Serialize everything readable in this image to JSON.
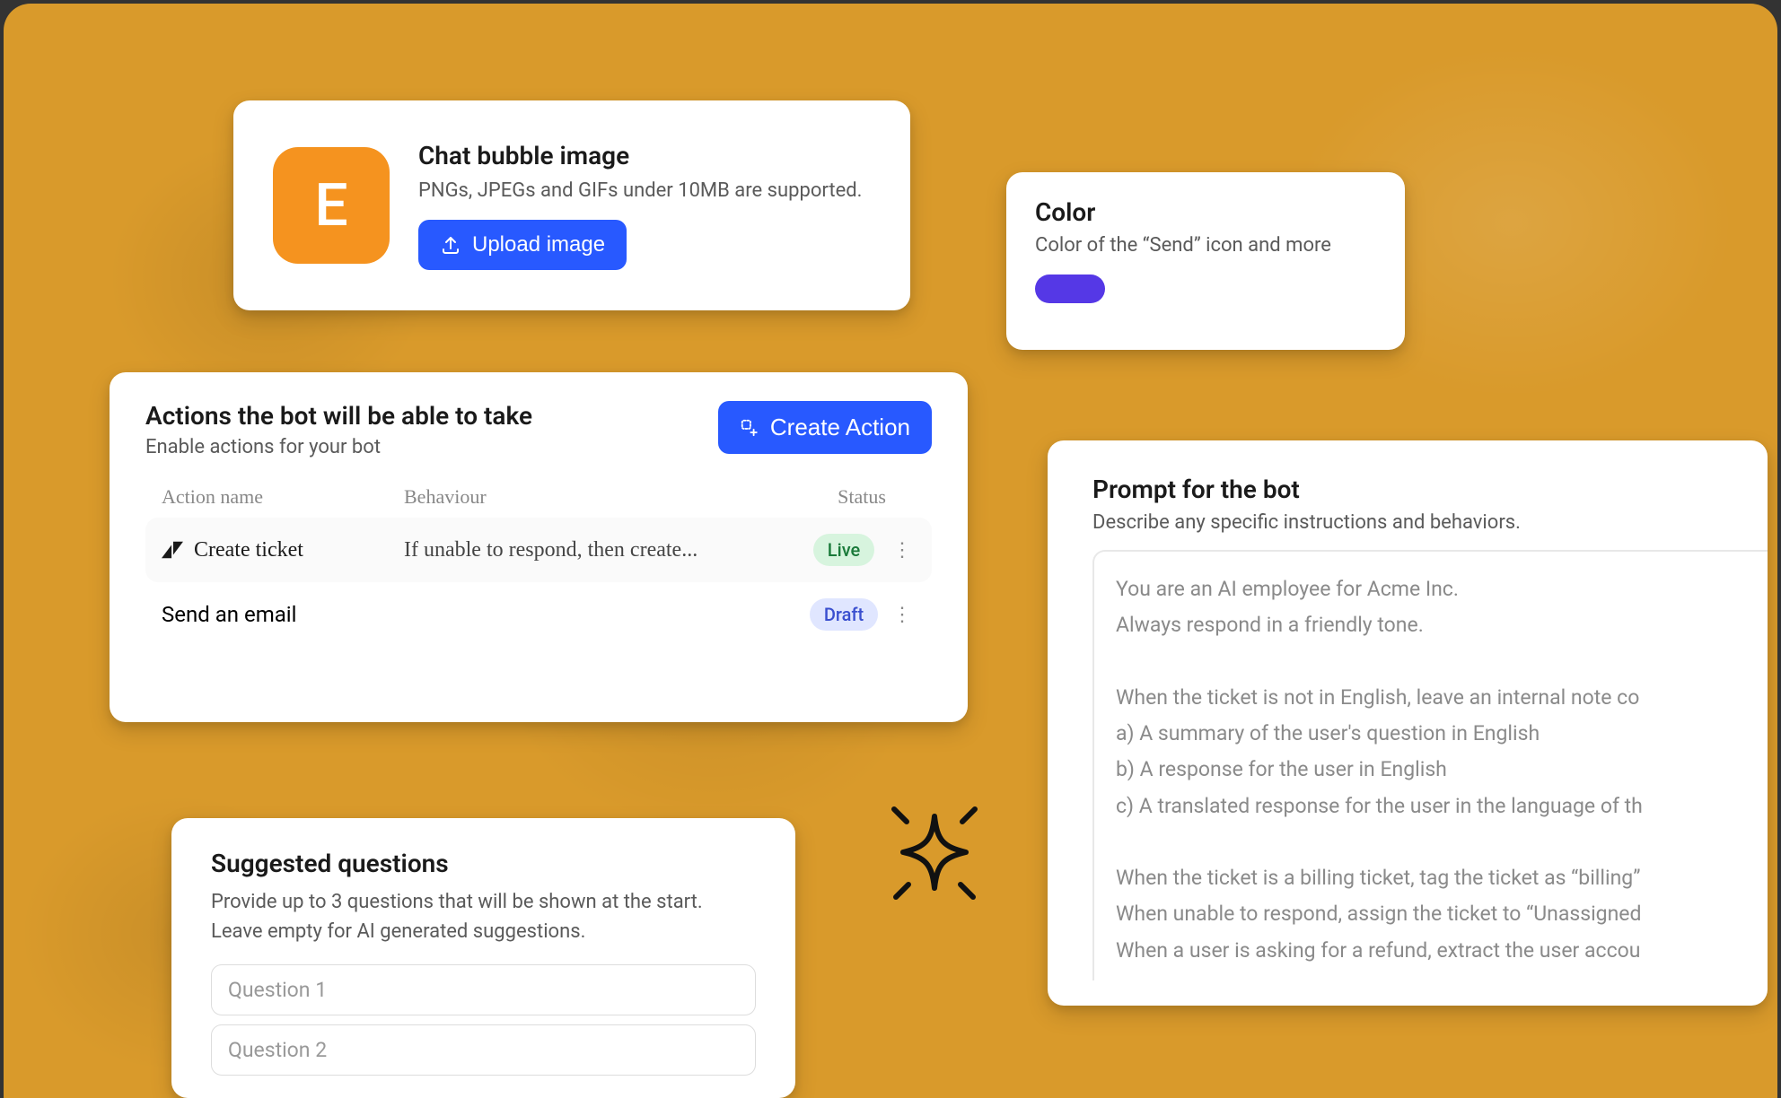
{
  "chatBubble": {
    "avatarLetter": "E",
    "title": "Chat bubble image",
    "subtitle": "PNGs, JPEGs and GIFs under 10MB are supported.",
    "uploadLabel": "Upload image"
  },
  "colorCard": {
    "title": "Color",
    "subtitle": "Color of the “Send” icon and more",
    "swatchHex": "#5538e6"
  },
  "actions": {
    "title": "Actions the bot will be able to take",
    "subtitle": "Enable actions for your bot",
    "createLabel": "Create Action",
    "columns": {
      "name": "Action name",
      "behaviour": "Behaviour",
      "status": "Status"
    },
    "rows": [
      {
        "icon": "zendesk",
        "name": "Create ticket",
        "behaviour": "If unable to respond, then create...",
        "status": "Live",
        "statusKind": "live"
      },
      {
        "icon": "",
        "name": "Send an email",
        "behaviour": "",
        "status": "Draft",
        "statusKind": "draft"
      }
    ]
  },
  "prompt": {
    "title": "Prompt for the bot",
    "subtitle": "Describe any specific instructions and behaviors.",
    "text": "You are an AI employee for Acme Inc.\nAlways respond in a friendly tone.\n\nWhen the ticket is not in English, leave an internal note co\na) A summary of the user's question in English\nb) A response for the user in English\nc) A translated response for the user in the language of th\n\nWhen the ticket is a billing ticket, tag the ticket as “billing”\nWhen unable to respond, assign the ticket to “Unassigned\nWhen a user is asking for a refund, extract the user accou"
  },
  "questions": {
    "title": "Suggested questions",
    "subtitle": "Provide up to 3 questions that will be shown at the start. Leave empty for AI generated suggestions.",
    "placeholders": [
      "Question 1",
      "Question 2"
    ]
  }
}
